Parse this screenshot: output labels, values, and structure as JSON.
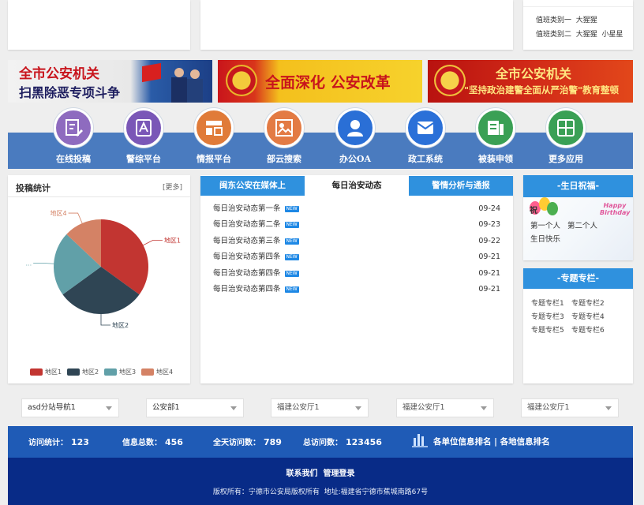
{
  "duty": {
    "row1": "值班类别一  大猩猩",
    "row2": "值班类别二  大猩猩  小星星"
  },
  "banners": [
    {
      "line1": "全市公安机关",
      "line2": "扫黑除恶专项斗争"
    },
    {
      "line1": "全面深化  公安改革"
    },
    {
      "line1": "全市公安机关",
      "line2": "\"坚持政治建警全面从严治警\"教育整顿"
    }
  ],
  "nav": {
    "items": [
      {
        "label": "在线投稿",
        "icon": "submission-icon",
        "color": "#8e6bbf"
      },
      {
        "label": "警综平台",
        "icon": "police-platform-icon",
        "color": "#7a57b7"
      },
      {
        "label": "情报平台",
        "icon": "intelligence-icon",
        "color": "#e07b39"
      },
      {
        "label": "部云搜索",
        "icon": "cloud-search-icon",
        "color": "#e37b44"
      },
      {
        "label": "办公OA",
        "icon": "office-oa-icon",
        "color": "#2a6fd6"
      },
      {
        "label": "政工系统",
        "icon": "political-system-icon",
        "color": "#2a70d8"
      },
      {
        "label": "被装申领",
        "icon": "uniform-apply-icon",
        "color": "#3aa055"
      },
      {
        "label": "更多应用",
        "icon": "more-apps-icon",
        "color": "#3aa055"
      }
    ]
  },
  "stats_panel": {
    "title": "投稿统计",
    "more": "[更多]"
  },
  "chart_data": {
    "type": "pie",
    "categories": [
      "地区1",
      "地区2",
      "地区3",
      "地区4"
    ],
    "values": [
      35,
      30,
      22,
      13
    ],
    "colors": [
      "#c23531",
      "#2f4554",
      "#61a0a8",
      "#d48265"
    ],
    "slice_labels": [
      "地区1",
      "地区2",
      "...",
      "地区4"
    ],
    "legend": "bottom"
  },
  "tabs": [
    "闽东公安在媒体上",
    "每日治安动态",
    "警情分析与通报"
  ],
  "news": [
    {
      "title": "每日治安动态第一条",
      "badge": "NEW",
      "date": "09-24"
    },
    {
      "title": "每日治安动态第二条",
      "badge": "NEW",
      "date": "09-23"
    },
    {
      "title": "每日治安动态第三条",
      "badge": "NEW",
      "date": "09-22"
    },
    {
      "title": "每日治安动态第四条",
      "badge": "NEW",
      "date": "09-21"
    },
    {
      "title": "每日治安动态第四条",
      "badge": "NEW",
      "date": "09-21"
    },
    {
      "title": "每日治安动态第四条",
      "badge": "NEW",
      "date": "09-21"
    }
  ],
  "birthday": {
    "title": "-生日祝福-",
    "balloon_text": "祝",
    "names": "第一个人   第二个人",
    "wish": "生日快乐",
    "card_text": "Happy Birthday"
  },
  "topics": {
    "title": "-专题专栏-",
    "items": [
      "专题专栏1",
      "专题专栏2",
      "专题专栏3",
      "专题专栏4",
      "专题专栏5",
      "专题专栏6"
    ]
  },
  "selects": [
    "asd分站导航1",
    "公安部1",
    "福建公安厅1",
    "福建公安厅1",
    "福建公安厅1"
  ],
  "footer_stats": [
    {
      "label": "访问统计：",
      "value": "123"
    },
    {
      "label": "信息总数：",
      "value": "456"
    },
    {
      "label": "全天访问数：",
      "value": "789"
    },
    {
      "label": "总访问数：",
      "value": "123456"
    }
  ],
  "ranking": "各单位信息排名 | 各地信息排名",
  "footer": {
    "links": "联系我们  管理登录",
    "copyright": "版权所有：宁德市公安局版权所有  地址:福建省宁德市蕉城南路67号"
  }
}
